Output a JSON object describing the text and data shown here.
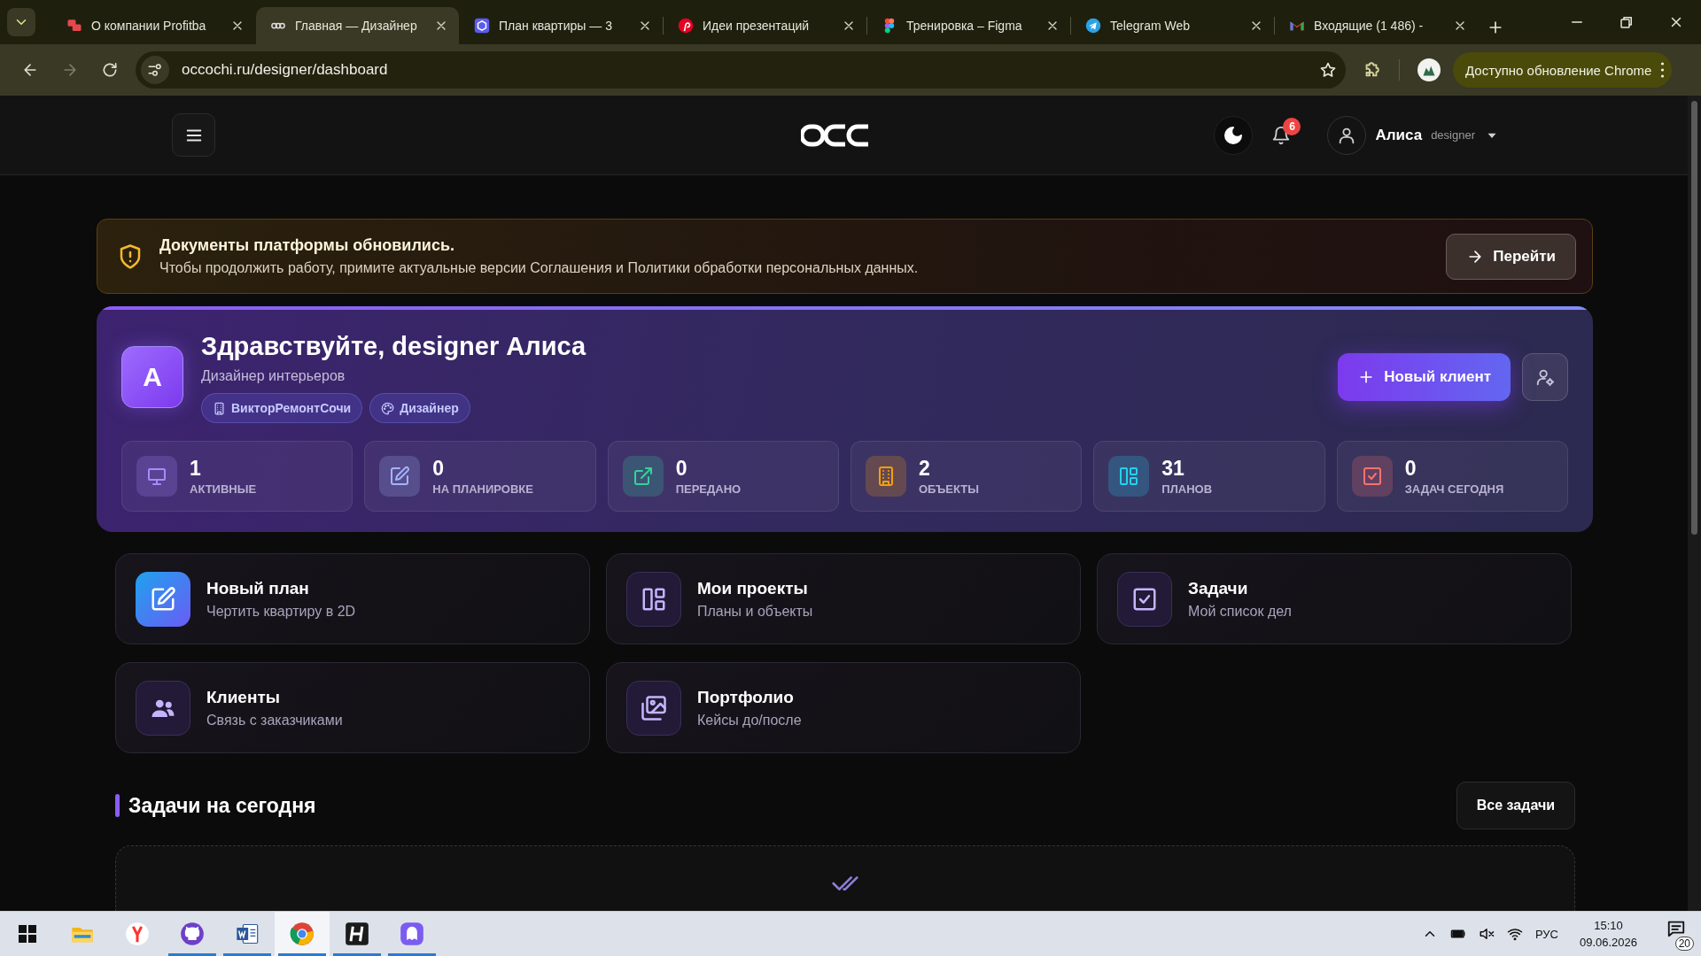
{
  "browser": {
    "tabs": [
      {
        "title": "О компании Profitba",
        "selected": false
      },
      {
        "title": "Главная — Дизайнер",
        "selected": true
      },
      {
        "title": "План квартиры — 3",
        "selected": false
      },
      {
        "title": "Идеи презентаций",
        "selected": false
      },
      {
        "title": "Тренировка – Figma",
        "selected": false
      },
      {
        "title": "Telegram Web",
        "selected": false
      },
      {
        "title": "Входящие (1 486) -",
        "selected": false
      }
    ],
    "address": "occochi.ru/designer/dashboard",
    "update_button": "Доступно обновление Chrome"
  },
  "header": {
    "notifications": "6",
    "user_name": "Алиса",
    "user_role": "designer"
  },
  "notice": {
    "title": "Документы платформы обновились.",
    "text": "Чтобы продолжить работу, примите актуальные версии Соглашения и Политики обработки персональных данных.",
    "button": "Перейти"
  },
  "profile": {
    "avatar": "А",
    "greeting": "Здравствуйте, designer Алиса",
    "subtitle": "Дизайнер интерьеров",
    "tags": [
      "ВикторРемонтСочи",
      "Дизайнер"
    ],
    "new_client_button": "Новый клиент",
    "stats": [
      {
        "value": "1",
        "label": "АКТИВНЫЕ",
        "color": "#a78bfa"
      },
      {
        "value": "0",
        "label": "НА ПЛАНИРОВКЕ",
        "color": "#a5b4fc"
      },
      {
        "value": "0",
        "label": "ПЕРЕДАНО",
        "color": "#34d399"
      },
      {
        "value": "2",
        "label": "ОБЪЕКТЫ",
        "color": "#f59e0b"
      },
      {
        "value": "31",
        "label": "ПЛАНОВ",
        "color": "#22d3ee"
      },
      {
        "value": "0",
        "label": "ЗАДАЧ СЕГОДНЯ",
        "color": "#f87171"
      }
    ]
  },
  "actions": [
    {
      "title": "Новый план",
      "subtitle": "Чертить квартиру в 2D",
      "kind": "primary"
    },
    {
      "title": "Мои проекты",
      "subtitle": "Планы и объекты",
      "kind": "default"
    },
    {
      "title": "Задачи",
      "subtitle": "Мой список дел",
      "kind": "default"
    },
    {
      "title": "Клиенты",
      "subtitle": "Связь с заказчиками",
      "kind": "default"
    },
    {
      "title": "Портфолио",
      "subtitle": "Кейсы до/после",
      "kind": "default"
    }
  ],
  "tasks": {
    "title": "Задачи на сегодня",
    "button": "Все задачи"
  },
  "taskbar": {
    "apps": [
      {
        "selected": false,
        "running": false
      },
      {
        "selected": false,
        "running": false
      },
      {
        "selected": false,
        "running": true
      },
      {
        "selected": false,
        "running": true
      },
      {
        "selected": true,
        "running": true
      },
      {
        "selected": false,
        "running": true
      },
      {
        "selected": false,
        "running": true
      }
    ],
    "language": "РУС",
    "time": "15:10",
    "date": "09.06.2026",
    "notifications": "20"
  }
}
